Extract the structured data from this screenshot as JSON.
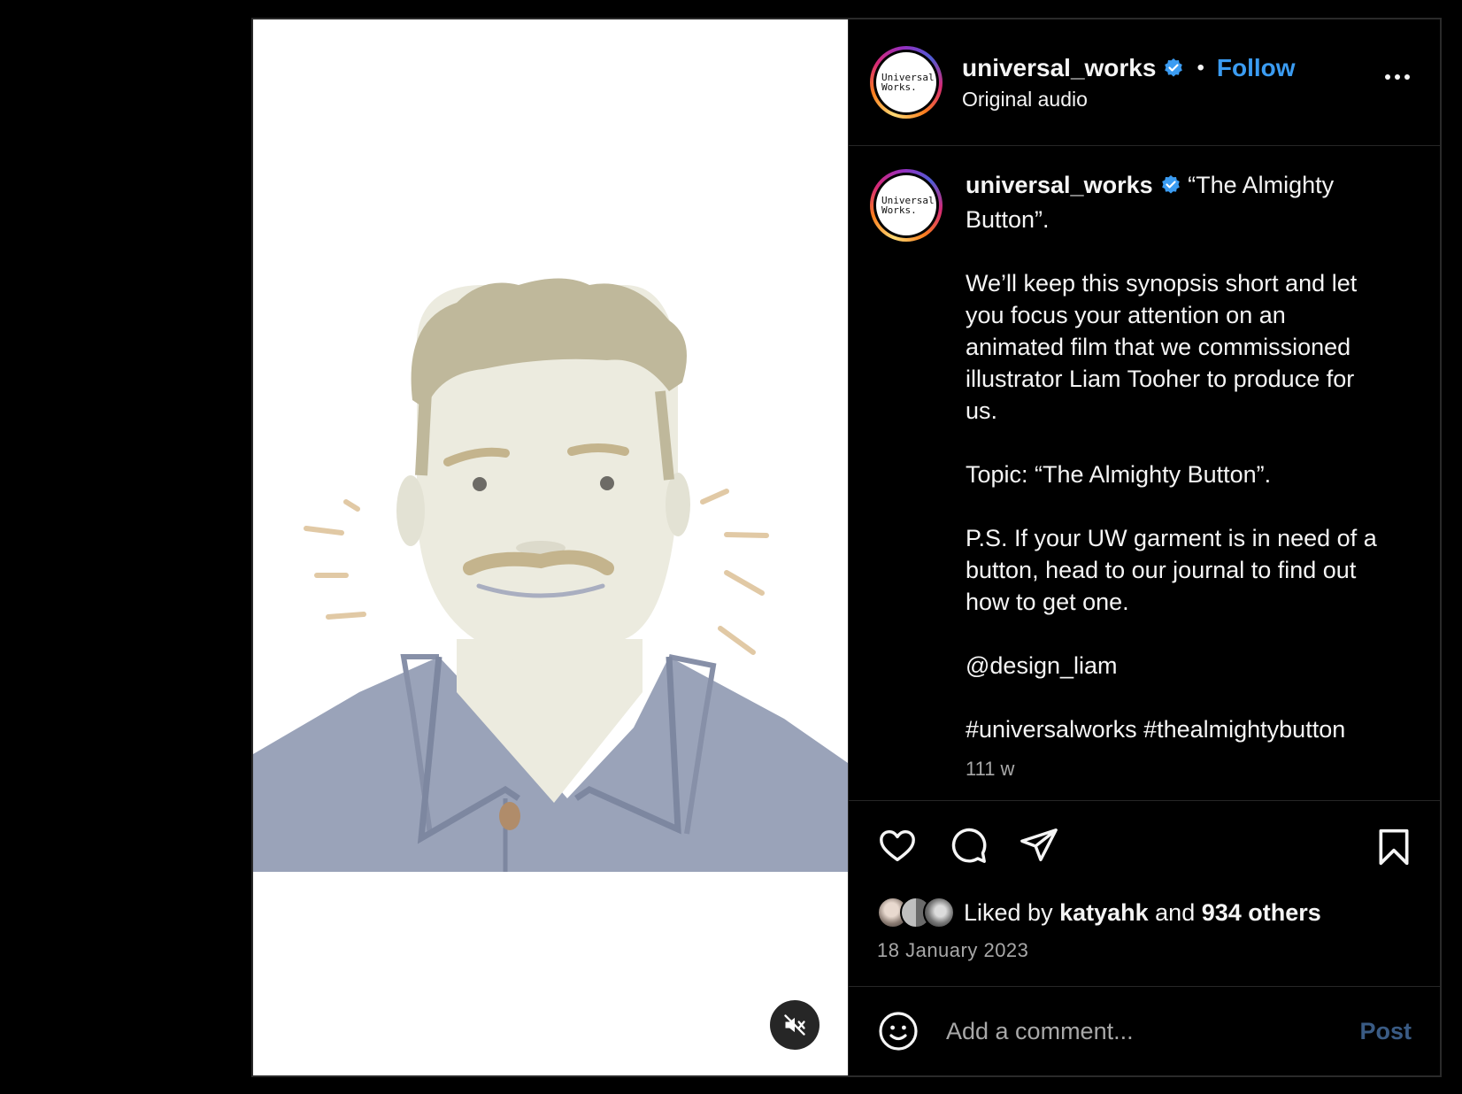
{
  "post": {
    "author": "universal_works",
    "avatar_text": [
      "Universal",
      "Works."
    ],
    "follow_label": "Follow",
    "separator": "•",
    "audio_label": "Original audio",
    "caption_text": " “The Almighty Button”.\n\nWe’ll keep this synopsis short and let you focus your attention on an animated film that we commissioned illustrator Liam Tooher to produce for us.\n\nTopic: “The Almighty Button”.\n\nP.S. If your UW garment is in need of a button, head to our journal to find out how to get one.\n\n@design_liam\n\n#universalworks #thealmightybutton",
    "caption_age": "111 w",
    "likes": {
      "prefix": "Liked by ",
      "first_user": "katyahk",
      "conjunction": " and ",
      "others": "934 others"
    },
    "date": "18 January 2023"
  },
  "comment": {
    "placeholder": "Add a comment...",
    "post_label": "Post"
  },
  "colors": {
    "verified": "#3b9cf2",
    "follow": "#3b9cf2",
    "post_disabled": "#3a5b84"
  },
  "icons": {
    "like": "heart-icon",
    "comment": "comment-bubble-icon",
    "share": "paper-plane-icon",
    "save": "bookmark-icon",
    "emoji": "smiley-icon",
    "mute": "speaker-muted-icon",
    "more": "more-options-icon",
    "verified": "verified-badge-icon"
  }
}
